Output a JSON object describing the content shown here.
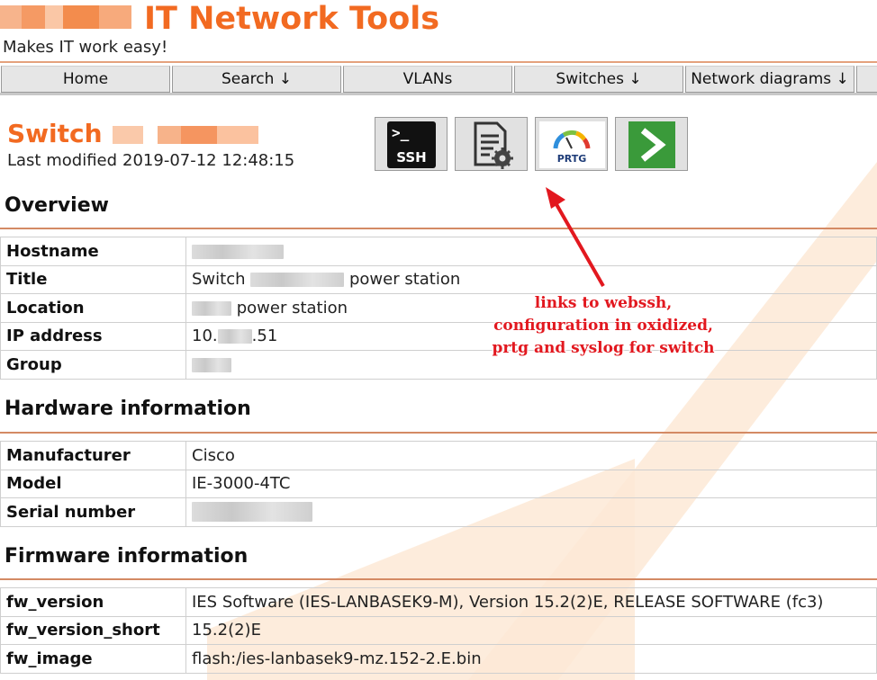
{
  "site": {
    "title": "IT Network Tools",
    "tagline": "Makes IT work easy!"
  },
  "nav": {
    "items": [
      {
        "label": "Home"
      },
      {
        "label": "Search ↓"
      },
      {
        "label": "VLANs"
      },
      {
        "label": "Switches ↓"
      },
      {
        "label": "Network diagrams ↓"
      }
    ]
  },
  "device": {
    "title_prefix": "Switch",
    "last_modified_label": "Last modified",
    "last_modified_value": "2019-07-12 12:48:15"
  },
  "tools": [
    {
      "name": "SSH",
      "icon": "ssh-terminal-icon"
    },
    {
      "name": "configuration",
      "icon": "config-document-gear-icon"
    },
    {
      "name": "PRTG",
      "icon": "prtg-gauge-icon"
    },
    {
      "name": "syslog",
      "icon": "syslog-arrow-icon"
    }
  ],
  "sections": {
    "overview": {
      "heading": "Overview",
      "rows": [
        {
          "key": "Hostname",
          "value": ""
        },
        {
          "key": "Title",
          "value_prefix": "Switch",
          "value_suffix": "power station"
        },
        {
          "key": "Location",
          "value_suffix": "power station"
        },
        {
          "key": "IP address",
          "value_prefix": "10.",
          "value_suffix": ".51"
        },
        {
          "key": "Group",
          "value": ""
        }
      ]
    },
    "hardware": {
      "heading": "Hardware information",
      "rows": [
        {
          "key": "Manufacturer",
          "value": "Cisco"
        },
        {
          "key": "Model",
          "value": "IE-3000-4TC"
        },
        {
          "key": "Serial number",
          "value": ""
        }
      ]
    },
    "firmware": {
      "heading": "Firmware information",
      "rows": [
        {
          "key": "fw_version",
          "value": "IES Software (IES-LANBASEK9-M), Version 15.2(2)E, RELEASE SOFTWARE (fc3)"
        },
        {
          "key": "fw_version_short",
          "value": "15.2(2)E"
        },
        {
          "key": "fw_image",
          "value": "flash:/ies-lanbasek9-mz.152-2.E.bin"
        }
      ]
    }
  },
  "annotation": {
    "lines": [
      "links to webssh,",
      "configuration in oxidized,",
      "prtg and syslog for switch"
    ],
    "color": "#e2181f"
  },
  "colors": {
    "brand": "#f26a21",
    "annotation": "#e2181f"
  }
}
